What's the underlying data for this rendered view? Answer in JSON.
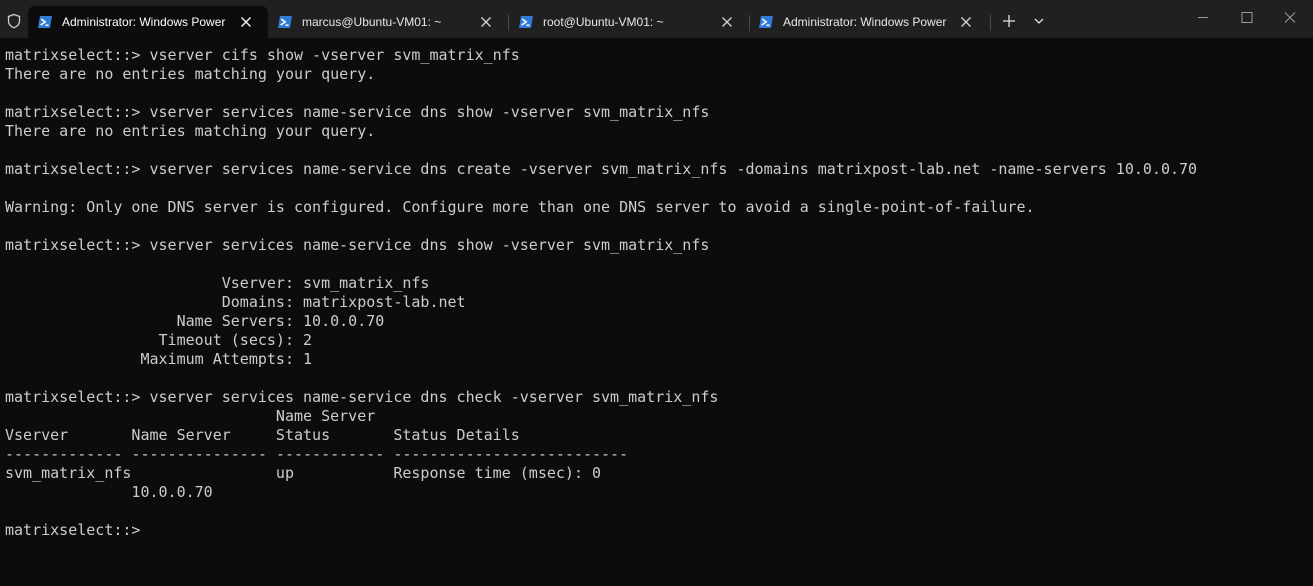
{
  "window": {
    "tabs": [
      {
        "label": "Administrator: Windows PowerShell",
        "icon": "powershell-icon",
        "active": true
      },
      {
        "label": "marcus@Ubuntu-VM01: ~",
        "icon": "powershell-icon",
        "active": false
      },
      {
        "label": "root@Ubuntu-VM01: ~",
        "icon": "powershell-icon",
        "active": false
      },
      {
        "label": "Administrator: Windows PowerShell",
        "icon": "powershell-icon",
        "active": false
      }
    ],
    "new_tab_icon": "plus-icon",
    "dropdown_icon": "chevron-down-icon",
    "shield_icon": "shield-icon",
    "controls": [
      "minimize-icon",
      "maximize-icon",
      "close-icon"
    ]
  },
  "colors": {
    "background": "#0c0c0c",
    "titlebar": "#202020",
    "text": "#cccccc",
    "powershell_blue": "#2f7bd8"
  },
  "terminal": {
    "lines": [
      "matrixselect::> vserver cifs show -vserver svm_matrix_nfs",
      "There are no entries matching your query.",
      "",
      "matrixselect::> vserver services name-service dns show -vserver svm_matrix_nfs",
      "There are no entries matching your query.",
      "",
      "matrixselect::> vserver services name-service dns create -vserver svm_matrix_nfs -domains matrixpost-lab.net -name-servers 10.0.0.70",
      "",
      "Warning: Only one DNS server is configured. Configure more than one DNS server to avoid a single-point-of-failure.",
      "",
      "matrixselect::> vserver services name-service dns show -vserver svm_matrix_nfs",
      "",
      "                        Vserver: svm_matrix_nfs",
      "                        Domains: matrixpost-lab.net",
      "                   Name Servers: 10.0.0.70",
      "                 Timeout (secs): 2",
      "               Maximum Attempts: 1",
      "",
      "matrixselect::> vserver services name-service dns check -vserver svm_matrix_nfs",
      "                              Name Server",
      "Vserver       Name Server     Status       Status Details",
      "------------- --------------- ------------ --------------------------",
      "svm_matrix_nfs                up           Response time (msec): 0",
      "              10.0.0.70",
      "",
      "matrixselect::>"
    ]
  }
}
